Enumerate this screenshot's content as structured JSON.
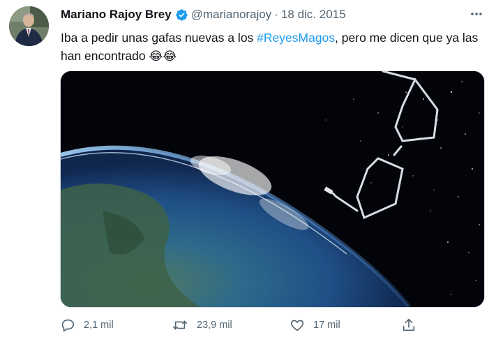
{
  "tweet": {
    "author_name": "Mariano Rajoy Brey",
    "handle": "@marianorajoy",
    "separator": "·",
    "date": "18 dic. 2015",
    "text_before": "Iba a pedir unas gafas nuevas a los ",
    "hashtag": "#ReyesMagos",
    "text_after": ", pero me dicen que ya las han encontrado ",
    "emojis": "😂😂"
  },
  "actions": {
    "reply_count": "2,1 mil",
    "retweet_count": "23,9 mil",
    "like_count": "17 mil"
  },
  "icons": {
    "verified": "verified-badge-icon",
    "more": "more-options-icon",
    "reply": "reply-icon",
    "retweet": "retweet-icon",
    "like": "heart-icon",
    "share": "share-icon"
  },
  "colors": {
    "accent": "#1d9bf0",
    "text": "#0f1419",
    "secondary_text": "#536471"
  }
}
